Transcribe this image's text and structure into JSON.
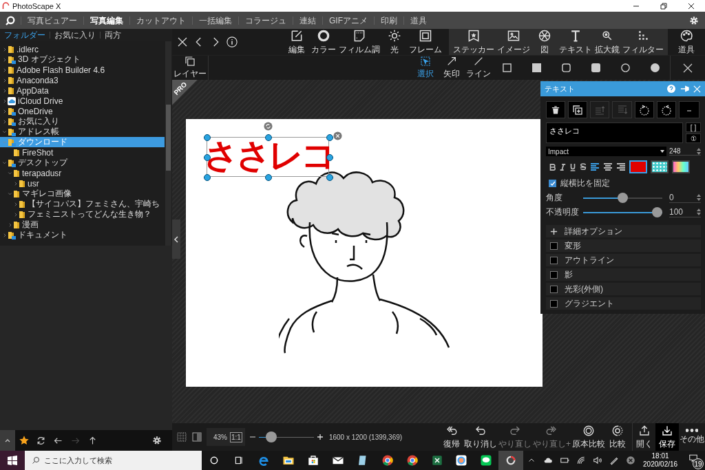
{
  "window": {
    "title": "PhotoScape X"
  },
  "menu": [
    {
      "label": "写真ビュアー",
      "selected": false
    },
    {
      "label": "写真編集",
      "selected": true
    },
    {
      "label": "カットアウト",
      "selected": false
    },
    {
      "label": "一括編集",
      "selected": false
    },
    {
      "label": "コラージュ",
      "selected": false
    },
    {
      "label": "連結",
      "selected": false
    },
    {
      "label": "GIFアニメ",
      "selected": false
    },
    {
      "label": "印刷",
      "selected": false
    },
    {
      "label": "道具",
      "selected": false
    }
  ],
  "browser_tabs": [
    {
      "label": "フォルダー",
      "selected": true
    },
    {
      "label": "お気に入り",
      "selected": false
    },
    {
      "label": "両方",
      "selected": false
    }
  ],
  "folder_tree": [
    {
      "label": ".idlerc",
      "kind": "folder",
      "expandable": true,
      "expanded": false,
      "selected": false
    },
    {
      "label": "3D オブジェクト",
      "kind": "special",
      "expandable": true,
      "expanded": false,
      "selected": false
    },
    {
      "label": "Adobe Flash Builder 4.6",
      "kind": "folder",
      "expandable": true,
      "expanded": false,
      "selected": false
    },
    {
      "label": "Anaconda3",
      "kind": "folder",
      "expandable": true,
      "expanded": false,
      "selected": false
    },
    {
      "label": "AppData",
      "kind": "folder",
      "expandable": true,
      "expanded": false,
      "selected": false
    },
    {
      "label": "iCloud Drive",
      "kind": "cloud",
      "expandable": true,
      "expanded": false,
      "selected": false
    },
    {
      "label": "OneDrive",
      "kind": "special",
      "expandable": true,
      "expanded": false,
      "selected": false
    },
    {
      "label": "お気に入り",
      "kind": "special",
      "expandable": true,
      "expanded": false,
      "selected": false
    },
    {
      "label": "アドレス帳",
      "kind": "special",
      "expandable": true,
      "expanded": true,
      "selected": false
    },
    {
      "label": "ダウンロード",
      "kind": "special",
      "expandable": true,
      "expanded": true,
      "selected": true,
      "children": [
        {
          "label": "FireShot",
          "kind": "folder",
          "expandable": false,
          "expanded": false,
          "selected": false
        }
      ]
    },
    {
      "label": "デスクトップ",
      "kind": "special",
      "expandable": true,
      "expanded": true,
      "selected": false,
      "children": [
        {
          "label": "terapadusr",
          "kind": "folder",
          "expandable": true,
          "expanded": true,
          "selected": false,
          "children": [
            {
              "label": "usr",
              "kind": "folder",
              "expandable": true,
              "expanded": false,
              "selected": false
            }
          ]
        },
        {
          "label": "マギレコ画像",
          "kind": "folder",
          "expandable": true,
          "expanded": true,
          "selected": false,
          "children": [
            {
              "label": "【サイコパス】フェミさん、宇崎ち",
              "kind": "folder",
              "expandable": true,
              "expanded": false,
              "selected": false
            },
            {
              "label": "フェミニストってどんな生き物？",
              "kind": "folder",
              "expandable": true,
              "expanded": false,
              "selected": false
            }
          ]
        },
        {
          "label": "漫画",
          "kind": "folder",
          "expandable": true,
          "expanded": false,
          "selected": false
        }
      ]
    },
    {
      "label": "ドキュメント",
      "kind": "special",
      "expandable": true,
      "expanded": false,
      "selected": false
    }
  ],
  "left_toolbar": {
    "forward_disabled": true
  },
  "edit_tools": [
    {
      "label": "編集"
    },
    {
      "label": "カラー"
    },
    {
      "label": "フィルム調"
    },
    {
      "label": "光"
    },
    {
      "label": "フレーム"
    }
  ],
  "insert_tools": [
    {
      "label": "ステッカー"
    },
    {
      "label": "イメージ"
    },
    {
      "label": "図"
    },
    {
      "label": "テキスト"
    },
    {
      "label": "拡大鏡"
    },
    {
      "label": "フィルター"
    }
  ],
  "tools_button": {
    "label": "道具"
  },
  "layer_button": {
    "label": "レイヤー"
  },
  "draw_tools": [
    {
      "label": "選択",
      "selected": true
    },
    {
      "label": "矢印",
      "selected": false
    },
    {
      "label": "ライン",
      "selected": false
    }
  ],
  "pro_badge": "PRO",
  "canvas": {
    "text": "ささレコ"
  },
  "text_panel": {
    "title": "テキスト",
    "text": "ささレコ",
    "bracket_button": "[ ]",
    "number_button": "①",
    "font": "Impact",
    "size": "248",
    "alignments": [
      {
        "selected": true
      },
      {
        "selected": false
      },
      {
        "selected": false
      }
    ],
    "fills": [
      {
        "kind": "solid",
        "color": "#e00000",
        "selected": true
      },
      {
        "kind": "pattern",
        "selected": false
      },
      {
        "kind": "gradient",
        "selected": false
      }
    ],
    "lock_aspect": {
      "label": "縦横比を固定",
      "checked": true
    },
    "sliders": [
      {
        "label": "角度",
        "level": 0.5,
        "reading": "0"
      },
      {
        "label": "不透明度",
        "level": 1,
        "reading": "100"
      }
    ],
    "more_options": "詳細オプション",
    "effects": [
      {
        "label": "変形",
        "checked": false
      },
      {
        "label": "アウトライン",
        "checked": false
      },
      {
        "label": "影",
        "checked": false
      },
      {
        "label": "光彩(外側)",
        "checked": false
      },
      {
        "label": "グラジエント",
        "checked": false
      }
    ]
  },
  "zoom": {
    "percent": "43%",
    "actual_size": "1:1",
    "level": 0.15
  },
  "image_info": "1600 x 1200 (1399,369)",
  "actions": [
    {
      "label": "復帰",
      "disabled": false,
      "emphasized": false
    },
    {
      "label": "取り消し",
      "disabled": false,
      "emphasized": false
    },
    {
      "label": "やり直し",
      "disabled": true,
      "emphasized": false
    },
    {
      "label": "やり直し+",
      "disabled": true,
      "emphasized": false
    },
    {
      "label": "原本比較",
      "disabled": false,
      "emphasized": false
    },
    {
      "label": "比較",
      "disabled": false,
      "emphasized": false
    },
    {
      "label": "開く",
      "disabled": false,
      "emphasized": false
    },
    {
      "label": "保存",
      "disabled": false,
      "emphasized": true
    },
    {
      "label": "その他",
      "disabled": false,
      "emphasized": false
    }
  ],
  "taskbar": {
    "search_placeholder": "ここに入力して検索",
    "time": "18:01",
    "date": "2020/02/16",
    "notification_count": "19"
  }
}
